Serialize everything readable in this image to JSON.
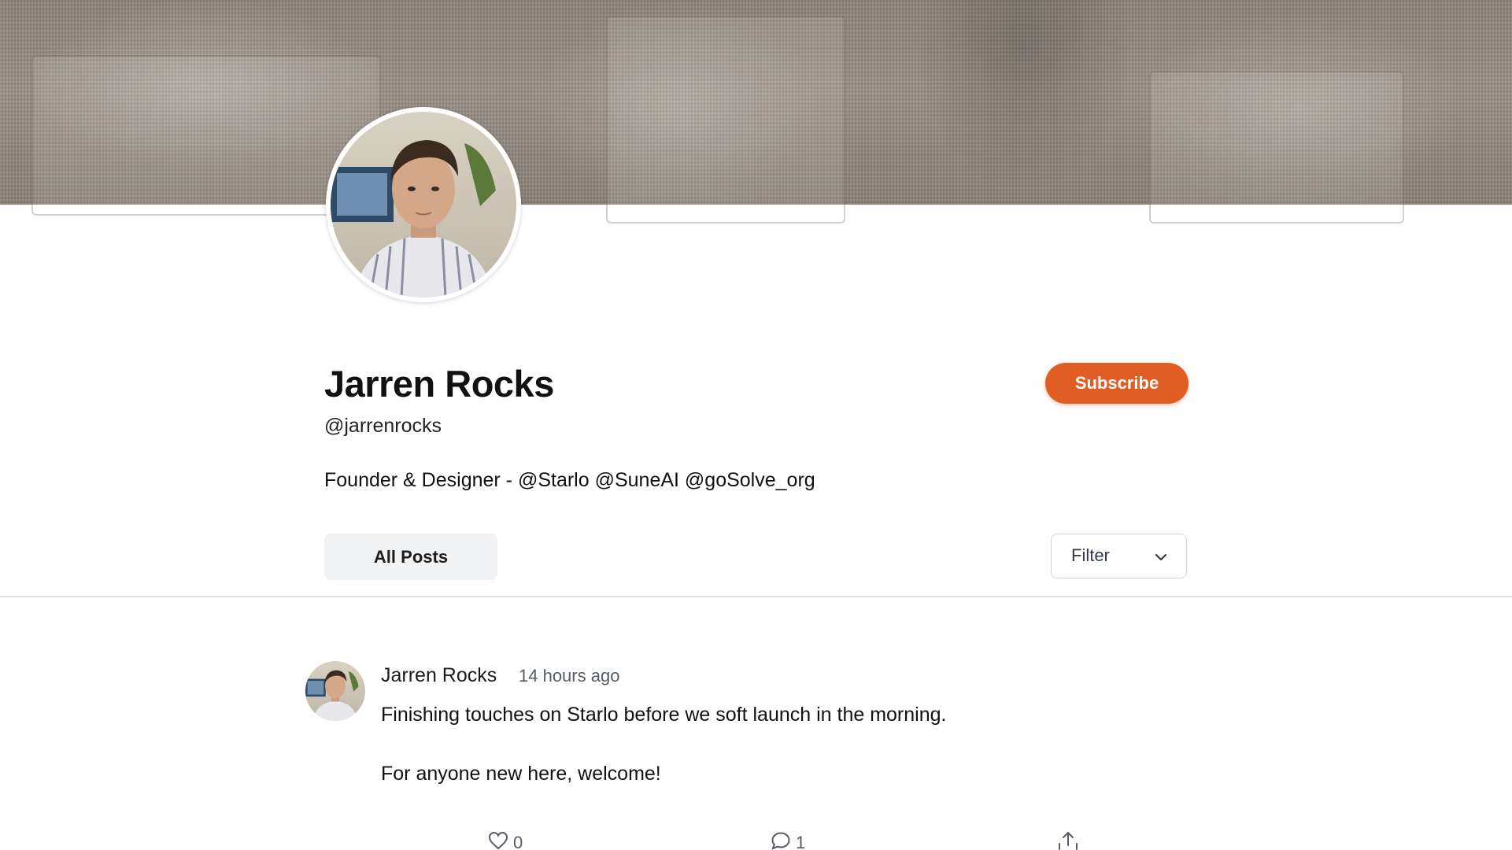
{
  "profile": {
    "name": "Jarren Rocks",
    "handle": "@jarrenrocks",
    "bio": "Founder & Designer - @Starlo @SuneAI @goSolve_org"
  },
  "actions": {
    "subscribe_label": "Subscribe"
  },
  "tabs": {
    "all_posts_label": "All Posts"
  },
  "filter": {
    "label": "Filter"
  },
  "colors": {
    "accent": "#e05d24",
    "tab_bg": "#f1f2f4",
    "divider": "#dfe1e4"
  },
  "posts": [
    {
      "author": "Jarren Rocks",
      "time": "14 hours ago",
      "lines": [
        "Finishing touches on Starlo before we soft launch in the morning.",
        "For anyone new here, welcome!"
      ],
      "likes": "0",
      "comments": "1",
      "icons": [
        "heart-icon",
        "comment-icon",
        "share-icon"
      ]
    }
  ]
}
